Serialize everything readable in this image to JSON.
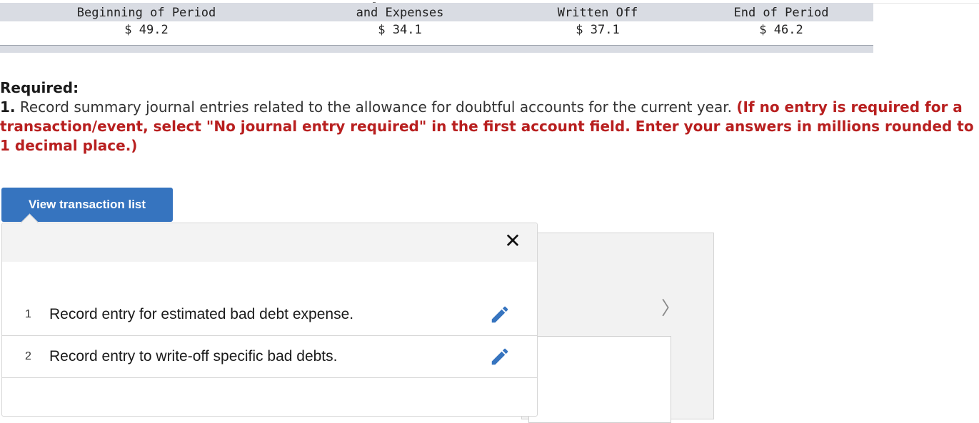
{
  "table": {
    "headers": [
      "Beginning of Period",
      "and Expenses",
      "Written Off",
      "End of Period"
    ],
    "values": [
      "$ 49.2",
      "$ 34.1",
      "$ 37.1",
      "$ 46.2"
    ]
  },
  "required": {
    "title": "Required:",
    "number": "1.",
    "instruction": " Record summary journal entries related to the allowance for doubtful accounts for the current year. ",
    "note": "(If no entry is required for a transaction/event, select \"No journal entry required\" in the first account field. Enter your answers in millions rounded to 1 decimal place.)"
  },
  "view_button": {
    "label": "View transaction list"
  },
  "popover": {
    "close_glyph": "✕",
    "items": [
      {
        "num": "1",
        "text": "Record entry for estimated bad debt expense."
      },
      {
        "num": "2",
        "text": "Record entry to write-off specific bad debts."
      }
    ]
  },
  "nav": {
    "next_glyph": "〉"
  },
  "colors": {
    "accent": "#3674bf",
    "note_red": "#b81f1f",
    "edit_blue": "#3674bf"
  },
  "icons": [
    "close-icon",
    "pencil-icon",
    "chevron-right-icon"
  ]
}
